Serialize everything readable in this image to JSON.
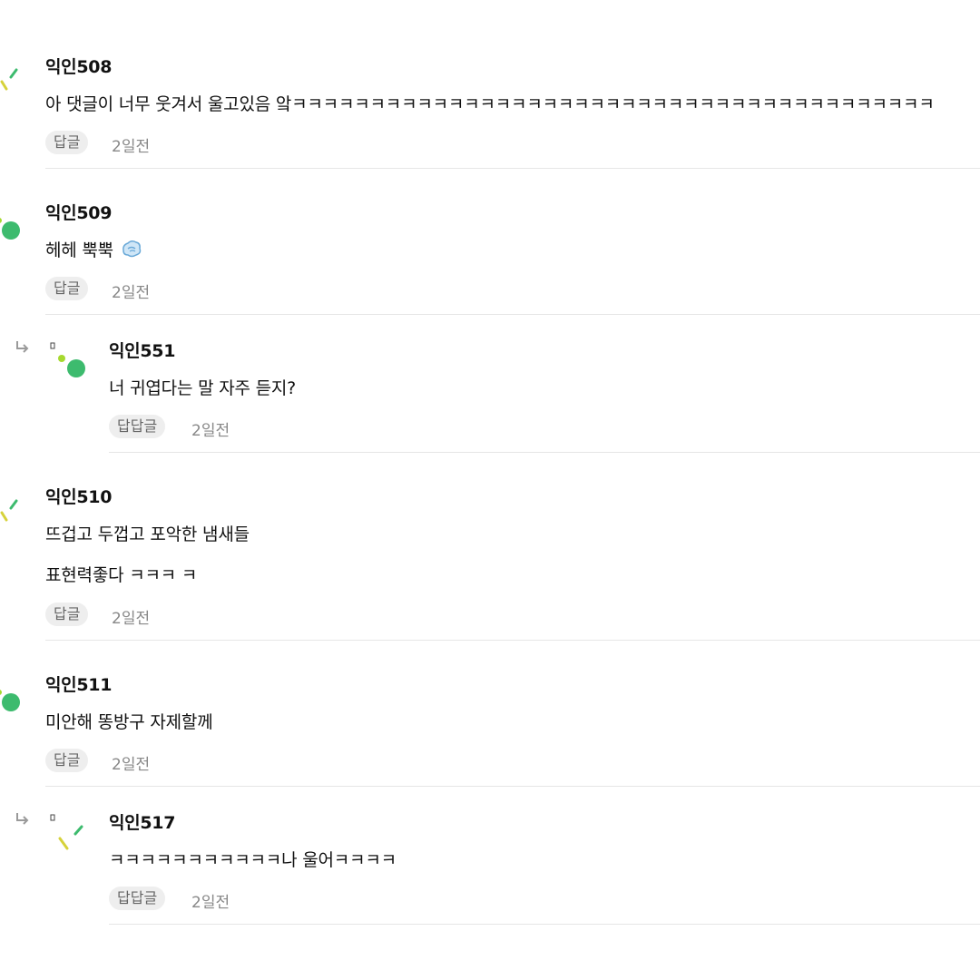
{
  "comments": [
    {
      "author": "익인508",
      "lines": [
        "아 댓글이 너무 웃겨서 울고있음 앜ㅋㅋㅋㅋㅋㅋㅋㅋㅋㅋㅋㅋㅋㅋㅋㅋㅋㅋㅋㅋㅋㅋㅋㅋㅋㅋㅋㅋㅋㅋㅋㅋㅋㅋㅋㅋㅋㅋㅋㅋㅋ"
      ],
      "reply_label": "답글",
      "time": "2일전"
    },
    {
      "author": "익인509",
      "lines": [
        "헤헤 뿍뿍"
      ],
      "emoji": "dash-emoji-icon",
      "reply_label": "답글",
      "time": "2일전"
    },
    {
      "author": "익인551",
      "lines": [
        "너 귀엽다는 말 자주 듣지?"
      ],
      "reply_label": "답답글",
      "time": "2일전",
      "nested": true
    },
    {
      "author": "익인510",
      "lines": [
        "뜨겁고 두껍고 포악한 냄새들",
        "표현력좋다 ㅋㅋㅋ ㅋ"
      ],
      "reply_label": "답글",
      "time": "2일전"
    },
    {
      "author": "익인511",
      "lines": [
        "미안해 똥방구 자제할께"
      ],
      "reply_label": "답글",
      "time": "2일전"
    },
    {
      "author": "익인517",
      "lines": [
        "ㅋㅋㅋㅋㅋㅋㅋㅋㅋㅋㅋ나 울어ㅋㅋㅋㅋ"
      ],
      "reply_label": "답답글",
      "time": "2일전",
      "nested": true
    }
  ],
  "colors": {
    "accent_green": "#3dbb6e",
    "accent_lime": "#a6d92f",
    "accent_yellow": "#d6d23a"
  }
}
